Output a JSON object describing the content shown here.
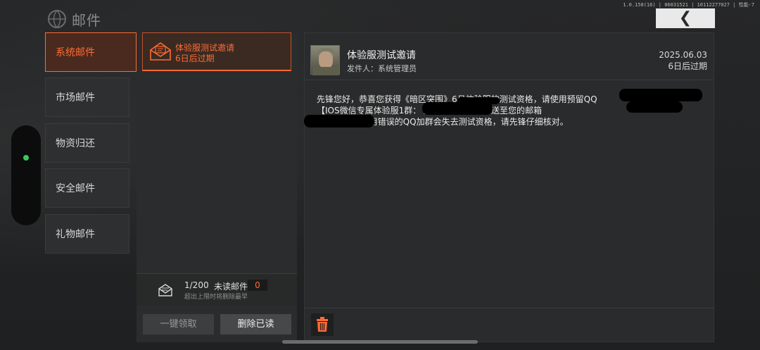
{
  "header": {
    "title": "邮件",
    "version": "1.0.158(16) | 06031521 | 10112277027 | 性能-7",
    "back_icon": "chevron-left-icon"
  },
  "categories": [
    {
      "label": "系统邮件",
      "active": true
    },
    {
      "label": "市场邮件",
      "active": false
    },
    {
      "label": "物资归还",
      "active": false
    },
    {
      "label": "安全邮件",
      "active": false
    },
    {
      "label": "礼物邮件",
      "active": false
    }
  ],
  "mail_list": {
    "items": [
      {
        "title": "体验服测试邀请",
        "expiry": "6日后过期",
        "icon": "envelope-open-icon"
      }
    ],
    "count": "1/200",
    "unread_label": "未读邮件",
    "unread_count": "0",
    "limit_note": "超出上限时将删除最早",
    "claim_all_label": "一键领取",
    "delete_read_label": "删除已读"
  },
  "detail": {
    "title": "体验服测试邀请",
    "sender": "发件人：系统管理员",
    "date": "2025.06.03",
    "expiry": "6日后过期",
    "body_lines": [
      "先锋您好，恭喜您获得《暗区突围》6月体验服的测试资格，请使用预留QQ",
      "【IOS微信专属体验服1群：                              届时下载资格将推送至您的邮箱",
      "                         qq.com】。使用错误的QQ加群会失去测试资格，请先锋仔细核对。"
    ],
    "delete_icon": "trash-icon"
  },
  "colors": {
    "accent": "#ff6a33",
    "background": "#232425",
    "status_dot": "#35c95a"
  }
}
